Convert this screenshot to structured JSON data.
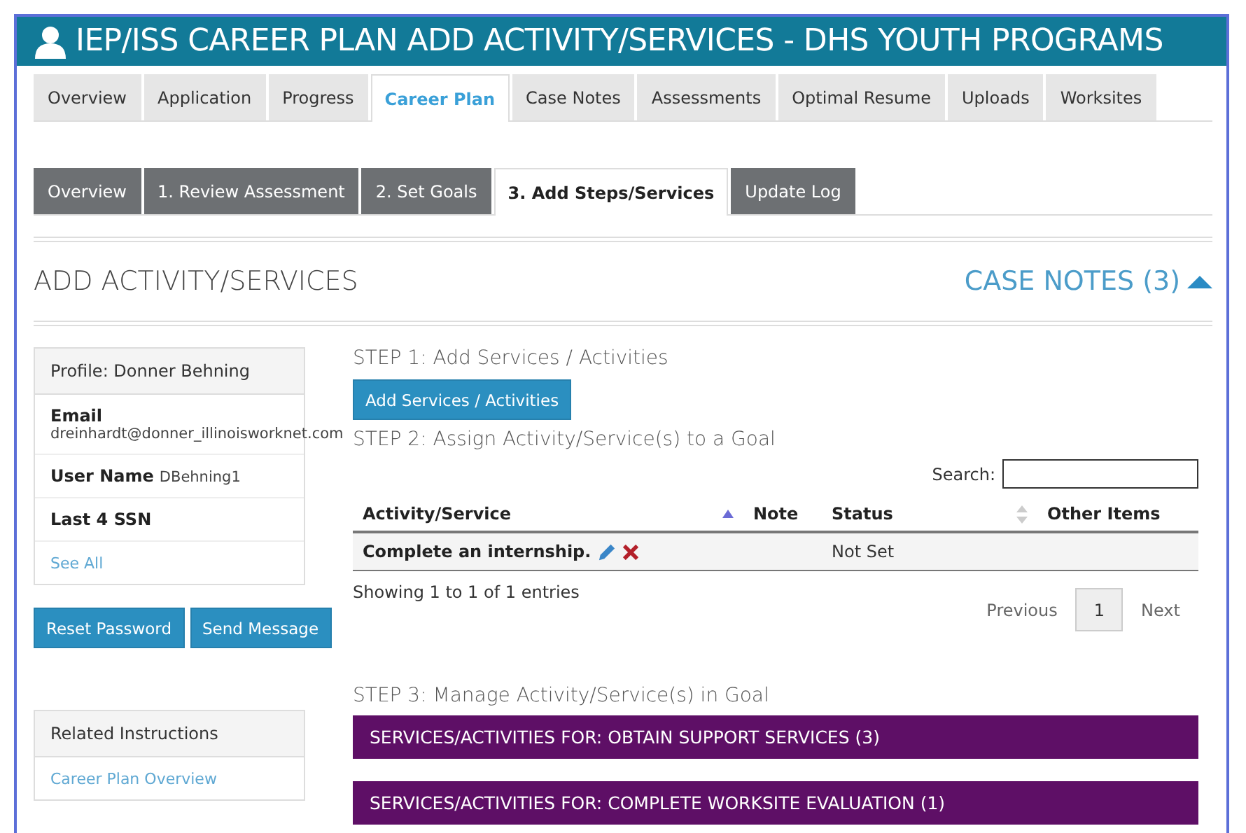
{
  "header": {
    "title": "IEP/ISS CAREER PLAN ADD ACTIVITY/SERVICES - DHS YOUTH PROGRAMS"
  },
  "tabs": [
    {
      "label": "Overview",
      "selected": false
    },
    {
      "label": "Application",
      "selected": false
    },
    {
      "label": "Progress",
      "selected": false
    },
    {
      "label": "Career Plan",
      "selected": true
    },
    {
      "label": "Case Notes",
      "selected": false
    },
    {
      "label": "Assessments",
      "selected": false
    },
    {
      "label": "Optimal Resume",
      "selected": false
    },
    {
      "label": "Uploads",
      "selected": false
    },
    {
      "label": "Worksites",
      "selected": false
    }
  ],
  "subtabs": [
    {
      "label": "Overview",
      "selected": false
    },
    {
      "label": "1. Review Assessment",
      "selected": false
    },
    {
      "label": "2. Set Goals",
      "selected": false
    },
    {
      "label": "3. Add Steps/Services",
      "selected": true
    },
    {
      "label": "Update Log",
      "selected": false
    }
  ],
  "section": {
    "title": "ADD ACTIVITY/SERVICES",
    "case_notes": "CASE NOTES (3)",
    "expanded": true
  },
  "profile": {
    "title": "Profile: Donner Behning",
    "fields": [
      {
        "label": "Email",
        "value": "dreinhardt@donner_illinoisworknet.com",
        "kind": "stacked"
      },
      {
        "label": "User Name",
        "value": "DBehning1",
        "kind": "inline"
      },
      {
        "label": "Last 4 SSN",
        "kind": "inline"
      }
    ],
    "link": "See All",
    "buttons": [
      "Reset Password",
      "Send Message"
    ]
  },
  "related": {
    "title": "Related Instructions",
    "links": [
      "Career Plan Overview"
    ]
  },
  "step1": {
    "title": "STEP 1: Add Services / Activities",
    "button": "Add Services / Activities"
  },
  "step2": {
    "title": "STEP 2: Assign Activity/Service(s) to a Goal",
    "search_label": "Search:",
    "columns": [
      {
        "label": "Activity/Service",
        "kind": "sorted"
      },
      {
        "label": "Note",
        "kind": "plain"
      },
      {
        "label": "Status",
        "kind": "sortable"
      },
      {
        "label": "Other Items",
        "kind": "plain"
      }
    ],
    "rows": [
      {
        "activity": "Complete an internship.",
        "status": "Not Set"
      }
    ],
    "info": "Showing 1 to 1 of 1 entries",
    "pager": [
      {
        "label": "Previous",
        "selected": false
      },
      {
        "label": "1",
        "selected": true
      },
      {
        "label": "Next",
        "selected": false
      }
    ]
  },
  "step3": {
    "title": "STEP 3: Manage Activity/Service(s) in Goal",
    "groups": [
      "SERVICES/ACTIVITIES FOR: OBTAIN SUPPORT SERVICES (3)",
      "SERVICES/ACTIVITIES FOR: COMPLETE WORKSITE EVALUATION (1)"
    ]
  }
}
